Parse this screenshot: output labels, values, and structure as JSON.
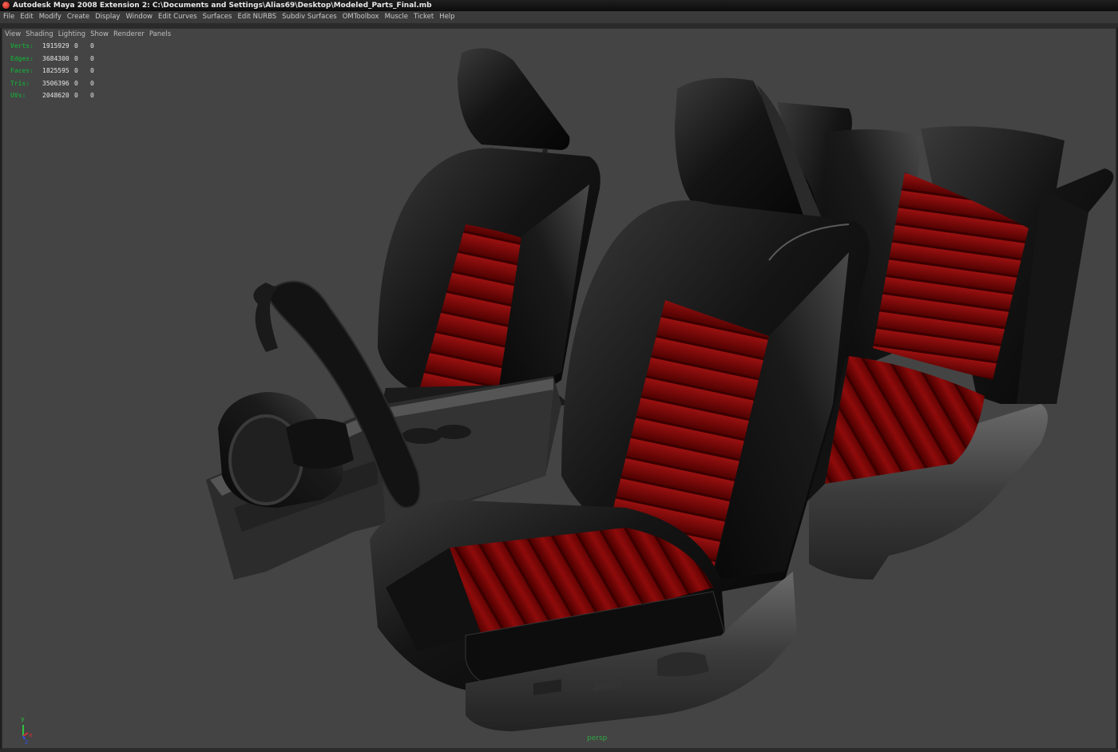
{
  "window": {
    "title": "Autodesk Maya 2008 Extension 2: C:\\Documents and Settings\\Alias69\\Desktop\\Modeled_Parts_Final.mb"
  },
  "main_menu": [
    "File",
    "Edit",
    "Modify",
    "Create",
    "Display",
    "Window",
    "Edit Curves",
    "Surfaces",
    "Edit NURBS",
    "Subdiv Surfaces",
    "OMToolbox",
    "Muscle",
    "Ticket",
    "Help"
  ],
  "panel_menu": [
    "View",
    "Shading",
    "Lighting",
    "Show",
    "Renderer",
    "Panels"
  ],
  "hud": [
    {
      "label": "Verts:",
      "total": "1915929",
      "sel": "0",
      "extra": "0"
    },
    {
      "label": "Edges:",
      "total": "3684300",
      "sel": "0",
      "extra": "0"
    },
    {
      "label": "Faces:",
      "total": "1825595",
      "sel": "0",
      "extra": "0"
    },
    {
      "label": "Tris:",
      "total": "3506396",
      "sel": "0",
      "extra": "0"
    },
    {
      "label": "UVs:",
      "total": "2048620",
      "sel": "0",
      "extra": "0"
    }
  ],
  "camera_label": "persp",
  "axis": {
    "x": "x",
    "y": "y",
    "z": "z"
  },
  "colors": {
    "viewport_bg": "#444444",
    "hud_label": "#1e9a3a",
    "leather_black": "#161616",
    "leather_red": "#8a0a0a"
  }
}
